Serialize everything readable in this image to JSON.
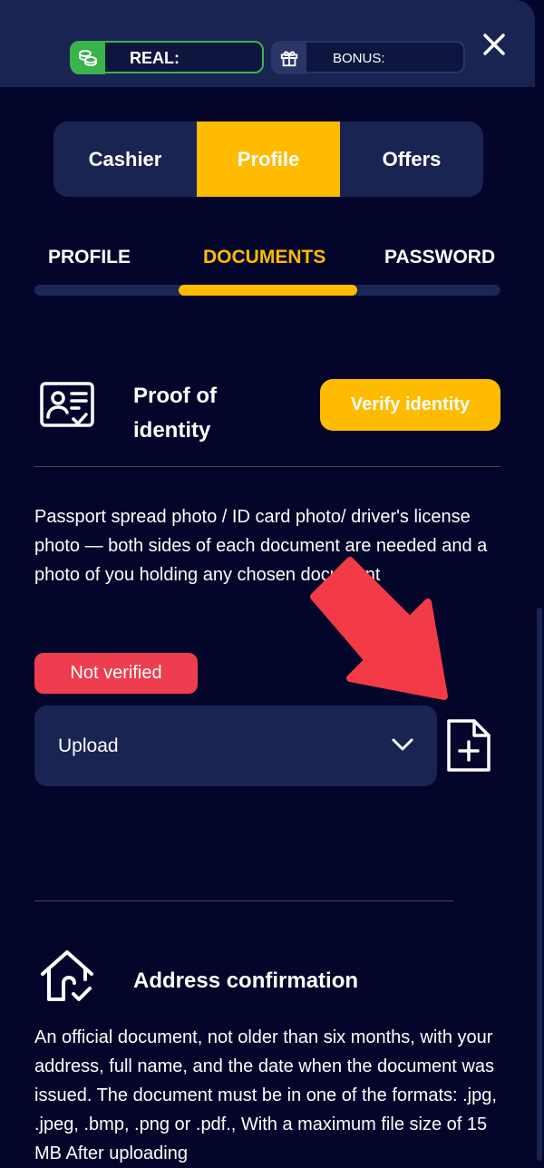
{
  "header": {
    "real_label": "REAL:",
    "bonus_label": "BONUS:"
  },
  "main_tabs": [
    {
      "label": "Cashier",
      "active": false
    },
    {
      "label": "Profile",
      "active": true
    },
    {
      "label": "Offers",
      "active": false
    }
  ],
  "sub_tabs": [
    {
      "label": "PROFILE",
      "active": false
    },
    {
      "label": "DOCUMENTS",
      "active": true
    },
    {
      "label": "PASSWORD",
      "active": false
    }
  ],
  "proof": {
    "title": "Proof of identity",
    "verify_label": "Verify identity",
    "description": "Passport spread photo / ID card photo/ driver's license photo — both sides of each document are needed and a photo of you holding any chosen document",
    "status": "Not verified",
    "select_value": "Upload"
  },
  "address": {
    "title": "Address confirmation",
    "description": "An official document, not older than six months, with your address, full name, and the date when the document was issued. The document must be in one of the formats: .jpg, .jpeg, .bmp, .png or .pdf., With a maximum file size of 15 MB After uploading"
  },
  "colors": {
    "background": "#04052a",
    "panel": "#1a2453",
    "accent": "#ffbb00",
    "success": "#39b34a",
    "danger": "#ee3d4f",
    "annotation_arrow": "#f23b46"
  }
}
